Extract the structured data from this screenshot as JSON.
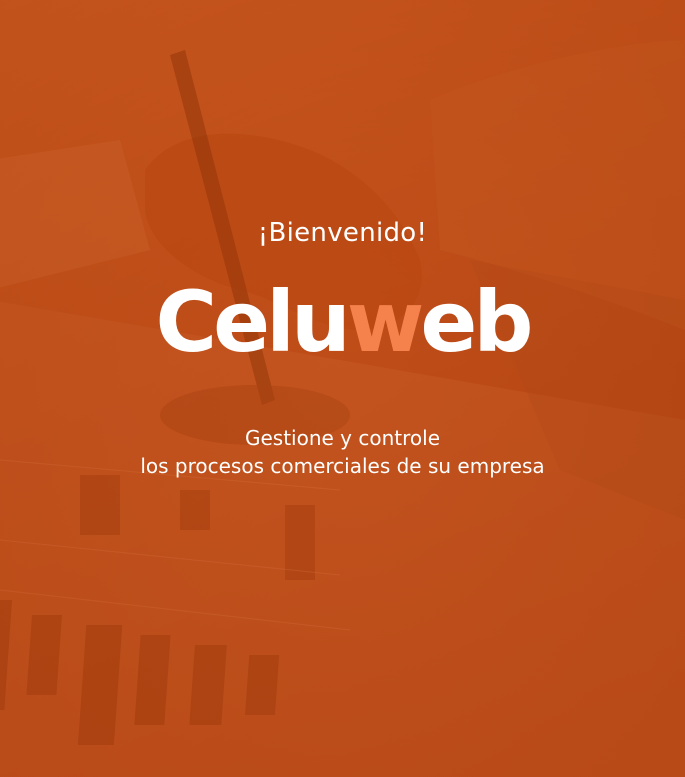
{
  "splash": {
    "welcome": "¡Bienvenido!",
    "logo": {
      "part1": "Celu",
      "part2": "w",
      "part3": "eb"
    },
    "tagline": {
      "line1": "Gestione y controle",
      "line2": "los procesos comerciales de su empresa"
    },
    "colors": {
      "background": "#bd4b17",
      "logo_primary": "#ffffff",
      "logo_accent": "#f5814d",
      "text": "#ffffff"
    },
    "background_image": "business-charts-with-pen-photo"
  }
}
